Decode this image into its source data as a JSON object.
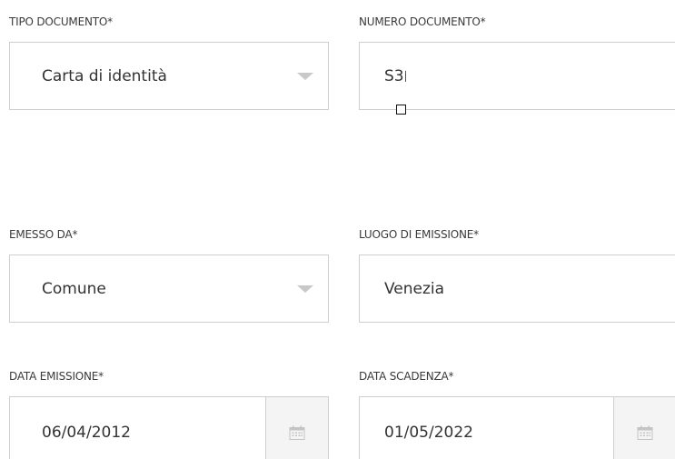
{
  "tipo_documento": {
    "label": "TIPO DOCUMENTO*",
    "value": "Carta di identità"
  },
  "numero_documento": {
    "label": "NUMERO DOCUMENTO*",
    "value": "S3"
  },
  "emesso_da": {
    "label": "EMESSO DA*",
    "value": "Comune"
  },
  "luogo_emissione": {
    "label": "LUOGO DI EMISSIONE*",
    "value": "Venezia"
  },
  "data_emissione": {
    "label": "DATA EMISSIONE*",
    "value": "06/04/2012"
  },
  "data_scadenza": {
    "label": "DATA SCADENZA*",
    "value": "01/05/2022"
  },
  "icons": {
    "dropdown": "chevron-down-icon",
    "date_picker": "calendar-icon",
    "pointer": "mouse-cursor"
  },
  "colors": {
    "border": "#cfcfcf",
    "text": "#333333",
    "caret": "#c8c8c8",
    "button_bg": "#f4f4f4"
  }
}
